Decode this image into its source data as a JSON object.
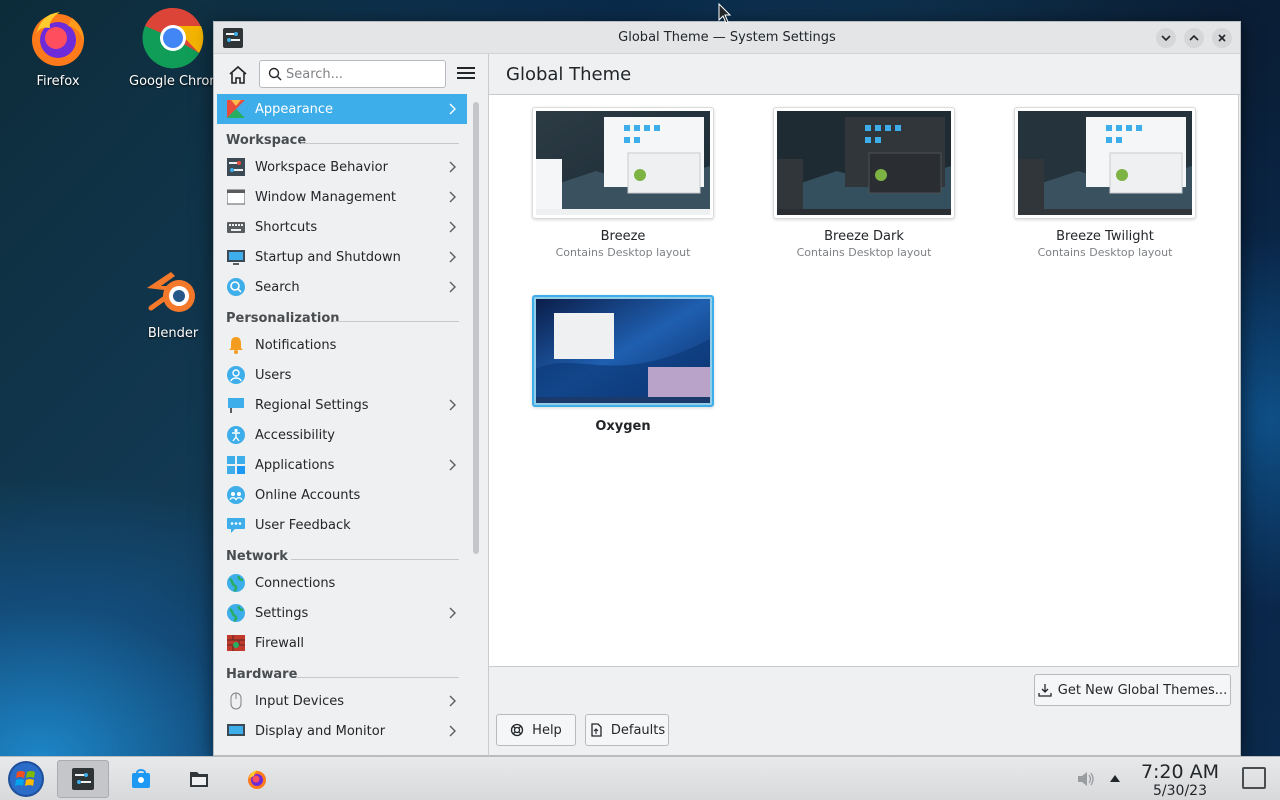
{
  "desktop": {
    "icons": [
      {
        "label": "Firefox",
        "icon": "firefox-icon"
      },
      {
        "label": "Google Chrome",
        "icon": "chrome-icon"
      },
      {
        "label": "Blender",
        "icon": "blender-icon"
      }
    ]
  },
  "window": {
    "title": "Global Theme — System Settings",
    "search": {
      "placeholder": "Search...",
      "value": ""
    },
    "page_title": "Global Theme",
    "sidebar": {
      "active": {
        "label": "Appearance"
      },
      "sections": [
        {
          "heading": "Workspace",
          "items": [
            {
              "label": "Workspace Behavior",
              "has_children": true
            },
            {
              "label": "Window Management",
              "has_children": true
            },
            {
              "label": "Shortcuts",
              "has_children": true
            },
            {
              "label": "Startup and Shutdown",
              "has_children": true
            },
            {
              "label": "Search",
              "has_children": true
            }
          ]
        },
        {
          "heading": "Personalization",
          "items": [
            {
              "label": "Notifications",
              "has_children": false
            },
            {
              "label": "Users",
              "has_children": false
            },
            {
              "label": "Regional Settings",
              "has_children": true
            },
            {
              "label": "Accessibility",
              "has_children": false
            },
            {
              "label": "Applications",
              "has_children": true
            },
            {
              "label": "Online Accounts",
              "has_children": false
            },
            {
              "label": "User Feedback",
              "has_children": false
            }
          ]
        },
        {
          "heading": "Network",
          "items": [
            {
              "label": "Connections",
              "has_children": false
            },
            {
              "label": "Settings",
              "has_children": true
            },
            {
              "label": "Firewall",
              "has_children": false
            }
          ]
        },
        {
          "heading": "Hardware",
          "items": [
            {
              "label": "Input Devices",
              "has_children": true
            },
            {
              "label": "Display and Monitor",
              "has_children": true
            }
          ]
        }
      ]
    },
    "themes": [
      {
        "name": "Breeze",
        "subtitle": "Contains Desktop layout",
        "selected": false
      },
      {
        "name": "Breeze Dark",
        "subtitle": "Contains Desktop layout",
        "selected": false
      },
      {
        "name": "Breeze Twilight",
        "subtitle": "Contains Desktop layout",
        "selected": false
      },
      {
        "name": "Oxygen",
        "subtitle": "",
        "selected": true
      }
    ],
    "buttons": {
      "get_new": "Get New Global Themes...",
      "help": "Help",
      "defaults": "Defaults"
    }
  },
  "taskbar": {
    "time": "7:20 AM",
    "date": "5/30/23"
  },
  "colors": {
    "accent": "#3daee9",
    "window_bg": "#eff0f1",
    "text": "#232629"
  }
}
